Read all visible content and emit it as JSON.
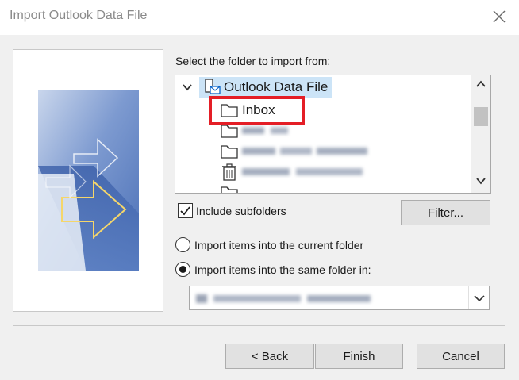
{
  "window": {
    "title": "Import Outlook Data File"
  },
  "folder_section": {
    "label": "Select the folder to import from:"
  },
  "tree": {
    "root": {
      "label": "Outlook Data File",
      "expanded": true
    },
    "items": [
      {
        "label": "Inbox",
        "icon": "folder-icon"
      },
      {
        "label": "",
        "icon": "folder-icon",
        "obscured": true
      },
      {
        "label": "",
        "icon": "folder-icon",
        "obscured": true
      },
      {
        "label": "",
        "icon": "trash-icon",
        "obscured": true
      },
      {
        "label": "",
        "icon": "folder-icon",
        "obscured": true
      }
    ]
  },
  "options": {
    "include_subfolders": {
      "label": "Include subfolders",
      "checked": true
    },
    "filter_button": "Filter...",
    "import_current": {
      "label": "Import items into the current folder",
      "selected": false
    },
    "import_same": {
      "label": "Import items into the same folder in:",
      "selected": true
    },
    "destination_dropdown": {
      "value": "",
      "obscured": true
    }
  },
  "buttons": {
    "back": "< Back",
    "finish": "Finish",
    "cancel": "Cancel"
  },
  "colors": {
    "highlight_box": "#e41e26",
    "selection": "#cce4f7"
  }
}
